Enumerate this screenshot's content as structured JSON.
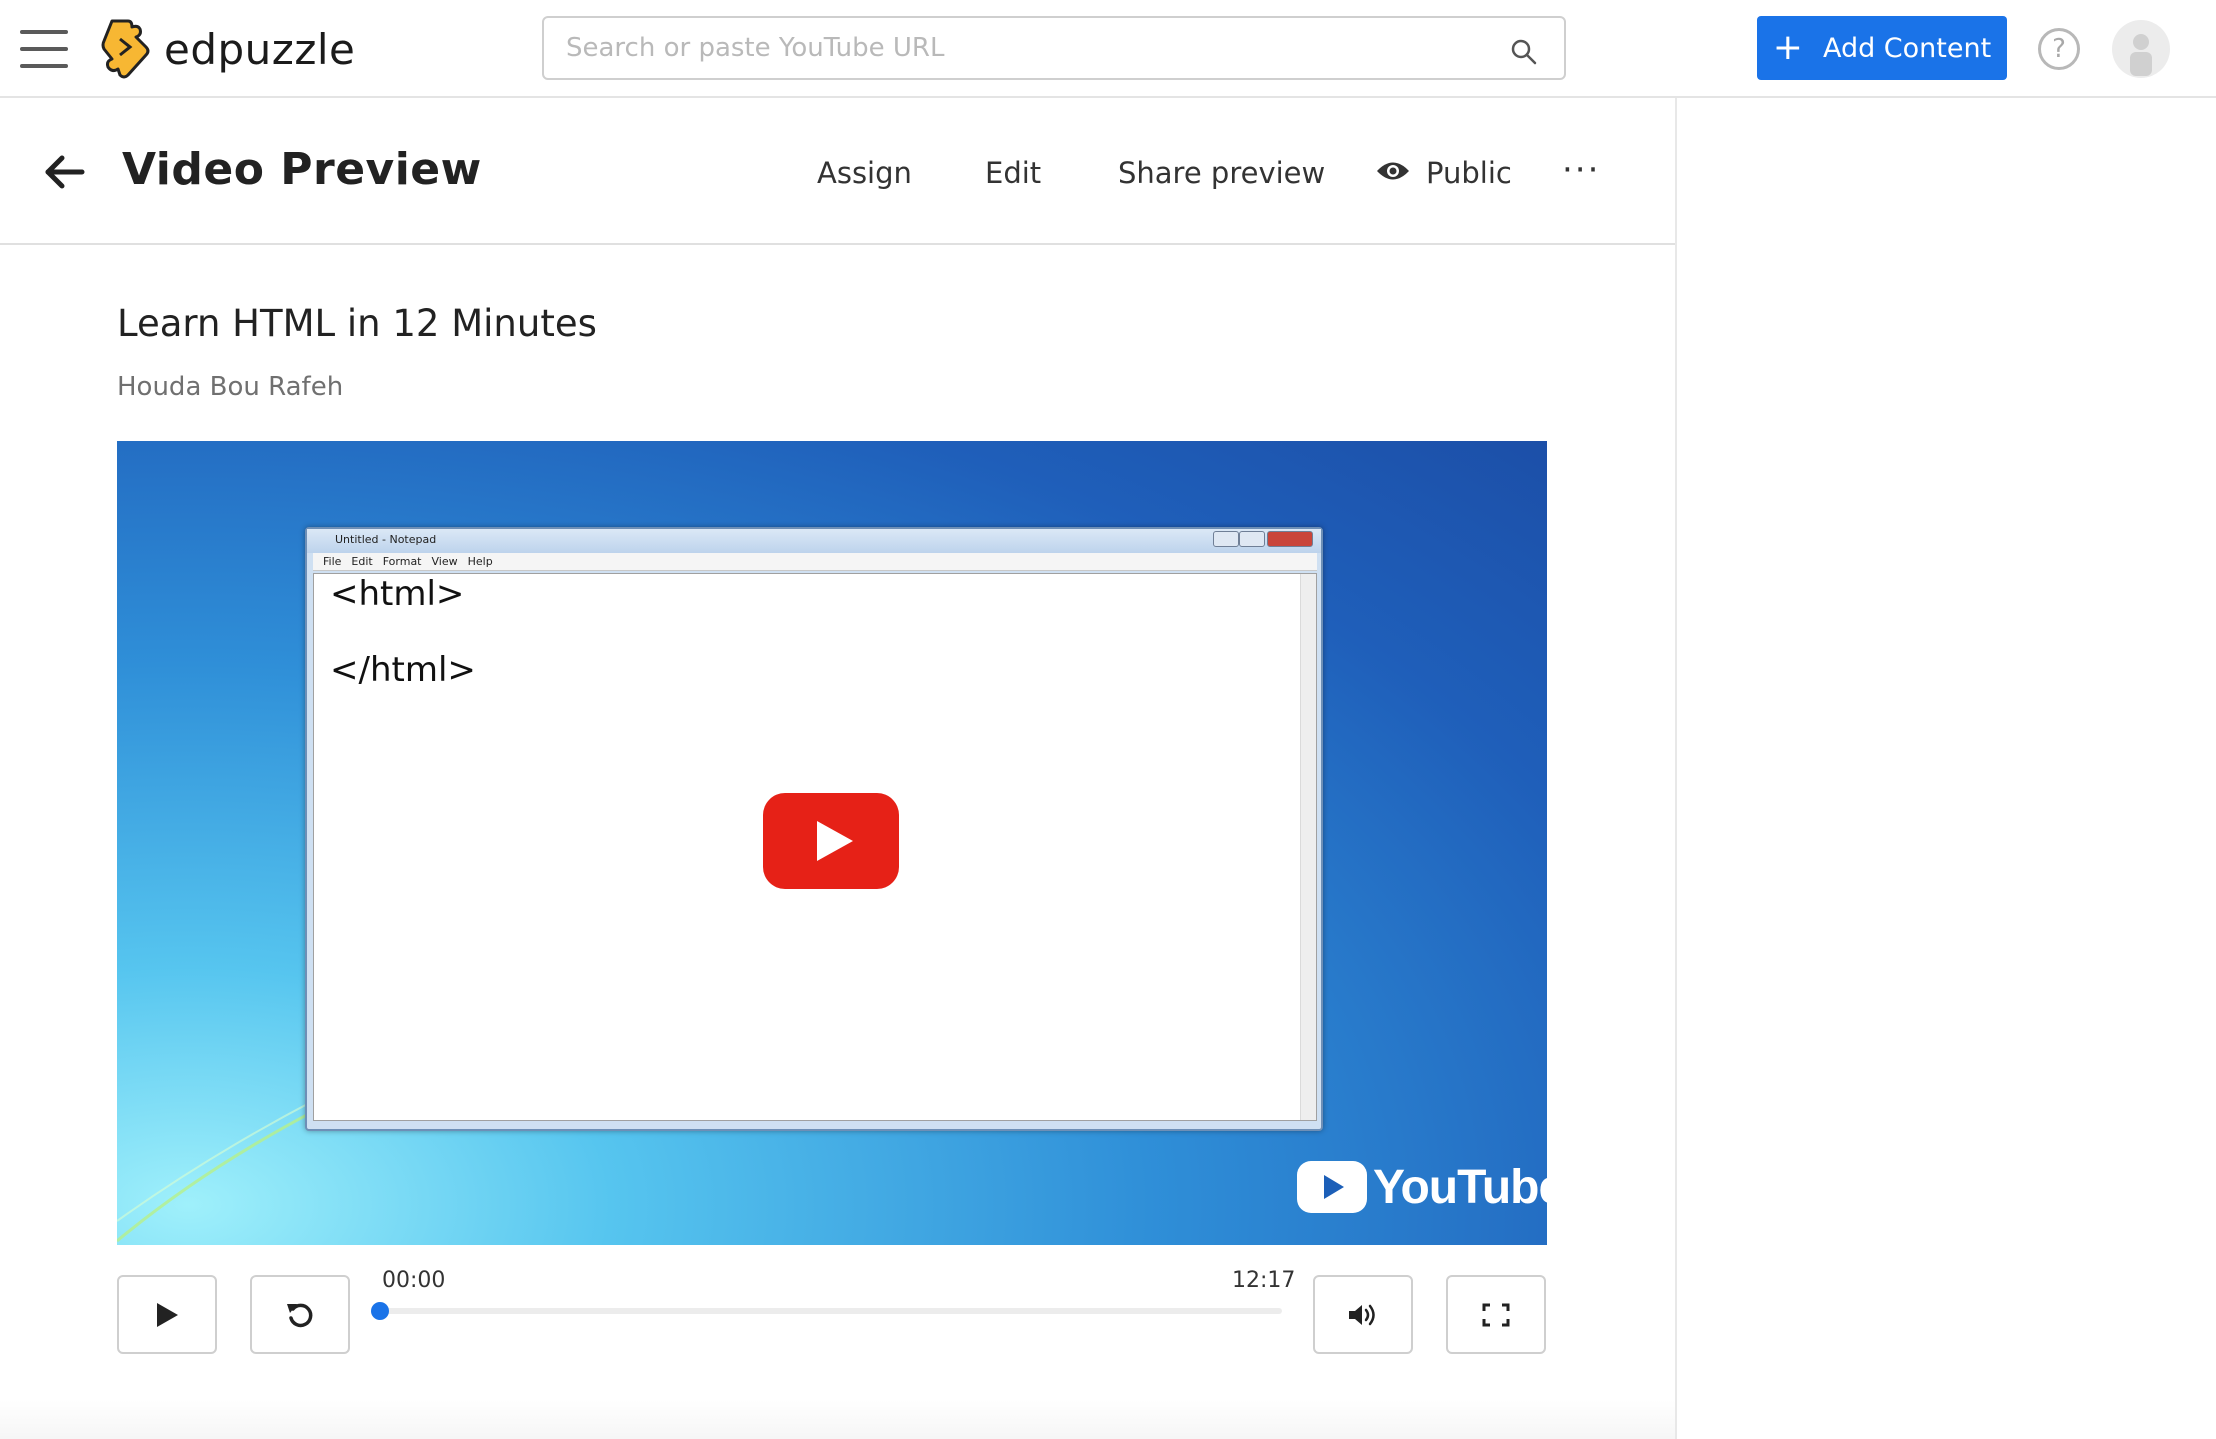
{
  "app": {
    "brand": "edpuzzle",
    "accent_color": "#1a73e8",
    "logo_color": "#f7b733"
  },
  "topbar": {
    "search_placeholder": "Search or paste YouTube URL",
    "add_content_label": "Add Content",
    "help_label": "?"
  },
  "subheader": {
    "title": "Video Preview",
    "tabs": [
      {
        "label": "Assign"
      },
      {
        "label": "Edit"
      },
      {
        "label": "Share preview"
      },
      {
        "label": "Public"
      }
    ],
    "more_label": "···"
  },
  "video": {
    "title": "Learn HTML in 12 Minutes",
    "author": "Houda Bou Rafeh",
    "thumbnail": {
      "notepad_title": "Untitled - Notepad",
      "notepad_menu": [
        "File",
        "Edit",
        "Format",
        "View",
        "Help"
      ],
      "code_lines": [
        "<html>",
        "</html>"
      ],
      "watermark": "YouTube"
    }
  },
  "player_controls": {
    "current_time": "00:00",
    "duration": "12:17",
    "progress_fraction": 0
  }
}
